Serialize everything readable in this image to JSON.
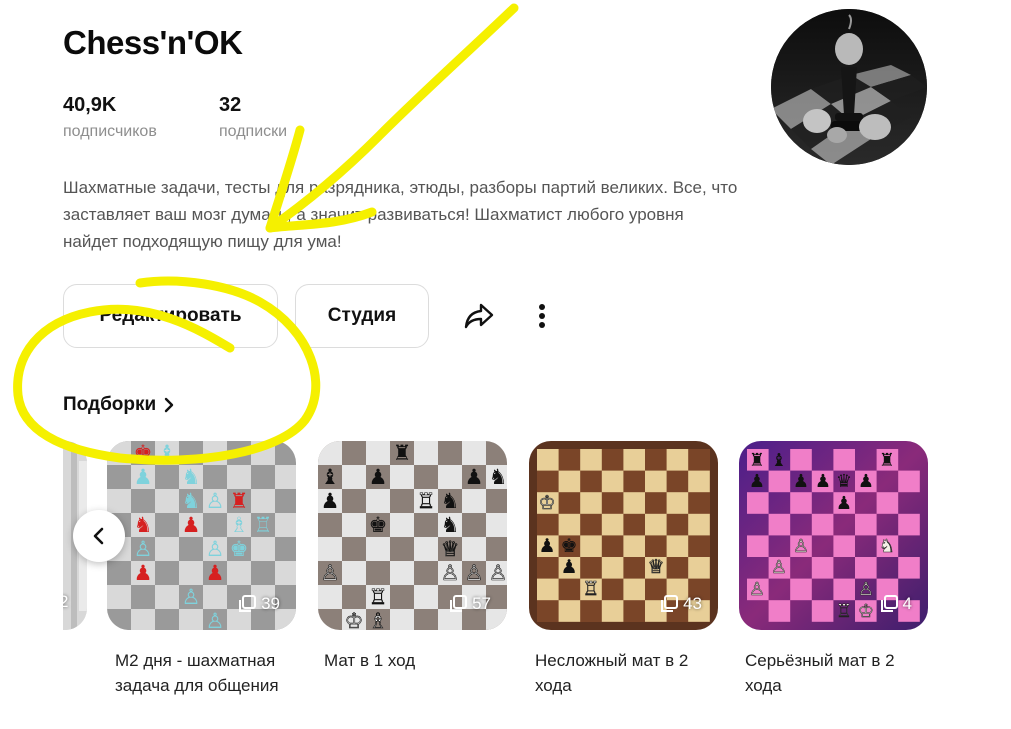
{
  "channel": {
    "title": "Chess'n'OK",
    "stats": [
      {
        "value": "40,9K",
        "label": "подписчиков"
      },
      {
        "value": "32",
        "label": "подписки"
      }
    ],
    "description": "Шахматные задачи, тесты для разрядника, этюды, разборы партий великих. Все, что заставляет ваш мозг думать, а значит развиваться! Шахматист любого уровня найдет подходящую пищу для ума!"
  },
  "actions": {
    "edit_label": "Редактировать",
    "studio_label": "Студия",
    "share_icon": "share-icon",
    "more_icon": "more-vertical-icon"
  },
  "collections": {
    "title": "Подборки",
    "partial_count": "2",
    "items": [
      {
        "title": "М2 дня - шахматная задача для общения",
        "count": "39",
        "theme": "gray-red-cyan"
      },
      {
        "title": "Мат в 1 ход",
        "count": "57",
        "theme": "gray-classic"
      },
      {
        "title": "Несложный мат в 2 хода",
        "count": "43",
        "theme": "wood"
      },
      {
        "title": "Серьёзный мат в 2 хода",
        "count": "4",
        "theme": "pink-purple"
      }
    ]
  },
  "colors": {
    "annotation": "#f5f000",
    "text_secondary": "#8e8e8e"
  }
}
